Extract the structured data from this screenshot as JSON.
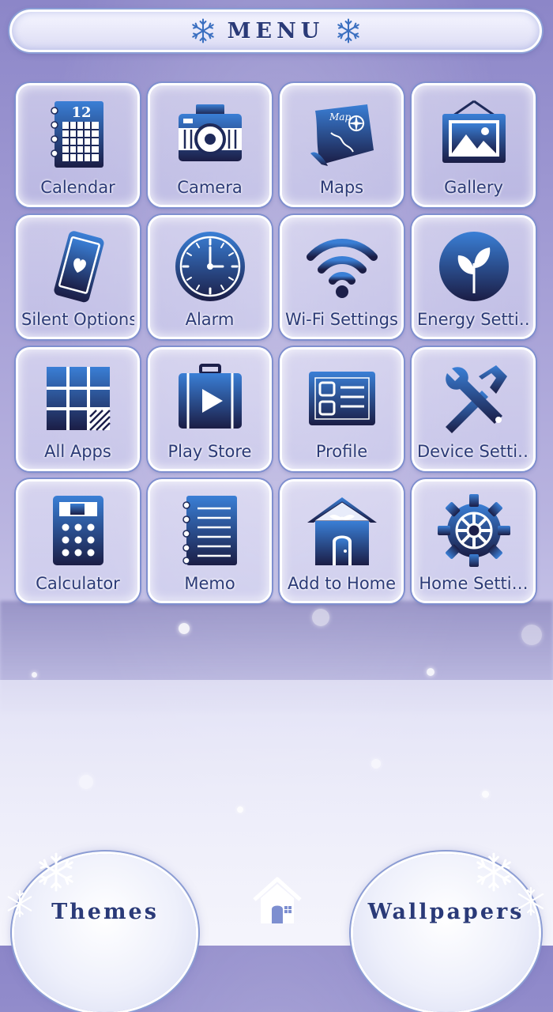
{
  "menu": {
    "title": "MENU"
  },
  "apps": [
    {
      "label": "Calendar",
      "icon": "calendar-icon",
      "number": "12"
    },
    {
      "label": "Camera",
      "icon": "camera-icon"
    },
    {
      "label": "Maps",
      "icon": "map-icon",
      "mark": "Map"
    },
    {
      "label": "Gallery",
      "icon": "gallery-icon"
    },
    {
      "label": "Silent Options",
      "icon": "phone-heart-icon"
    },
    {
      "label": "Alarm",
      "icon": "clock-icon"
    },
    {
      "label": "Wi-Fi Settings",
      "icon": "wifi-icon"
    },
    {
      "label": "Energy Setti…",
      "icon": "leaf-icon"
    },
    {
      "label": "All Apps",
      "icon": "grid-icon"
    },
    {
      "label": "Play Store",
      "icon": "suitcase-play-icon"
    },
    {
      "label": "Profile",
      "icon": "id-card-icon"
    },
    {
      "label": "Device Setti…",
      "icon": "tools-icon"
    },
    {
      "label": "Calculator",
      "icon": "calculator-icon"
    },
    {
      "label": "Memo",
      "icon": "notebook-icon"
    },
    {
      "label": "Add to Home",
      "icon": "house-icon"
    },
    {
      "label": "Home Setti…",
      "icon": "gear-icon"
    }
  ],
  "bottom": {
    "themes_label": "Themes",
    "wallpapers_label": "Wallpapers",
    "home_icon": "home-icon"
  },
  "colors": {
    "icon_gradient_top": "#2f6fc6",
    "icon_gradient_bottom": "#1c1f4a",
    "label_text": "#2b3a76",
    "tile_border": "#7f8fcf"
  }
}
